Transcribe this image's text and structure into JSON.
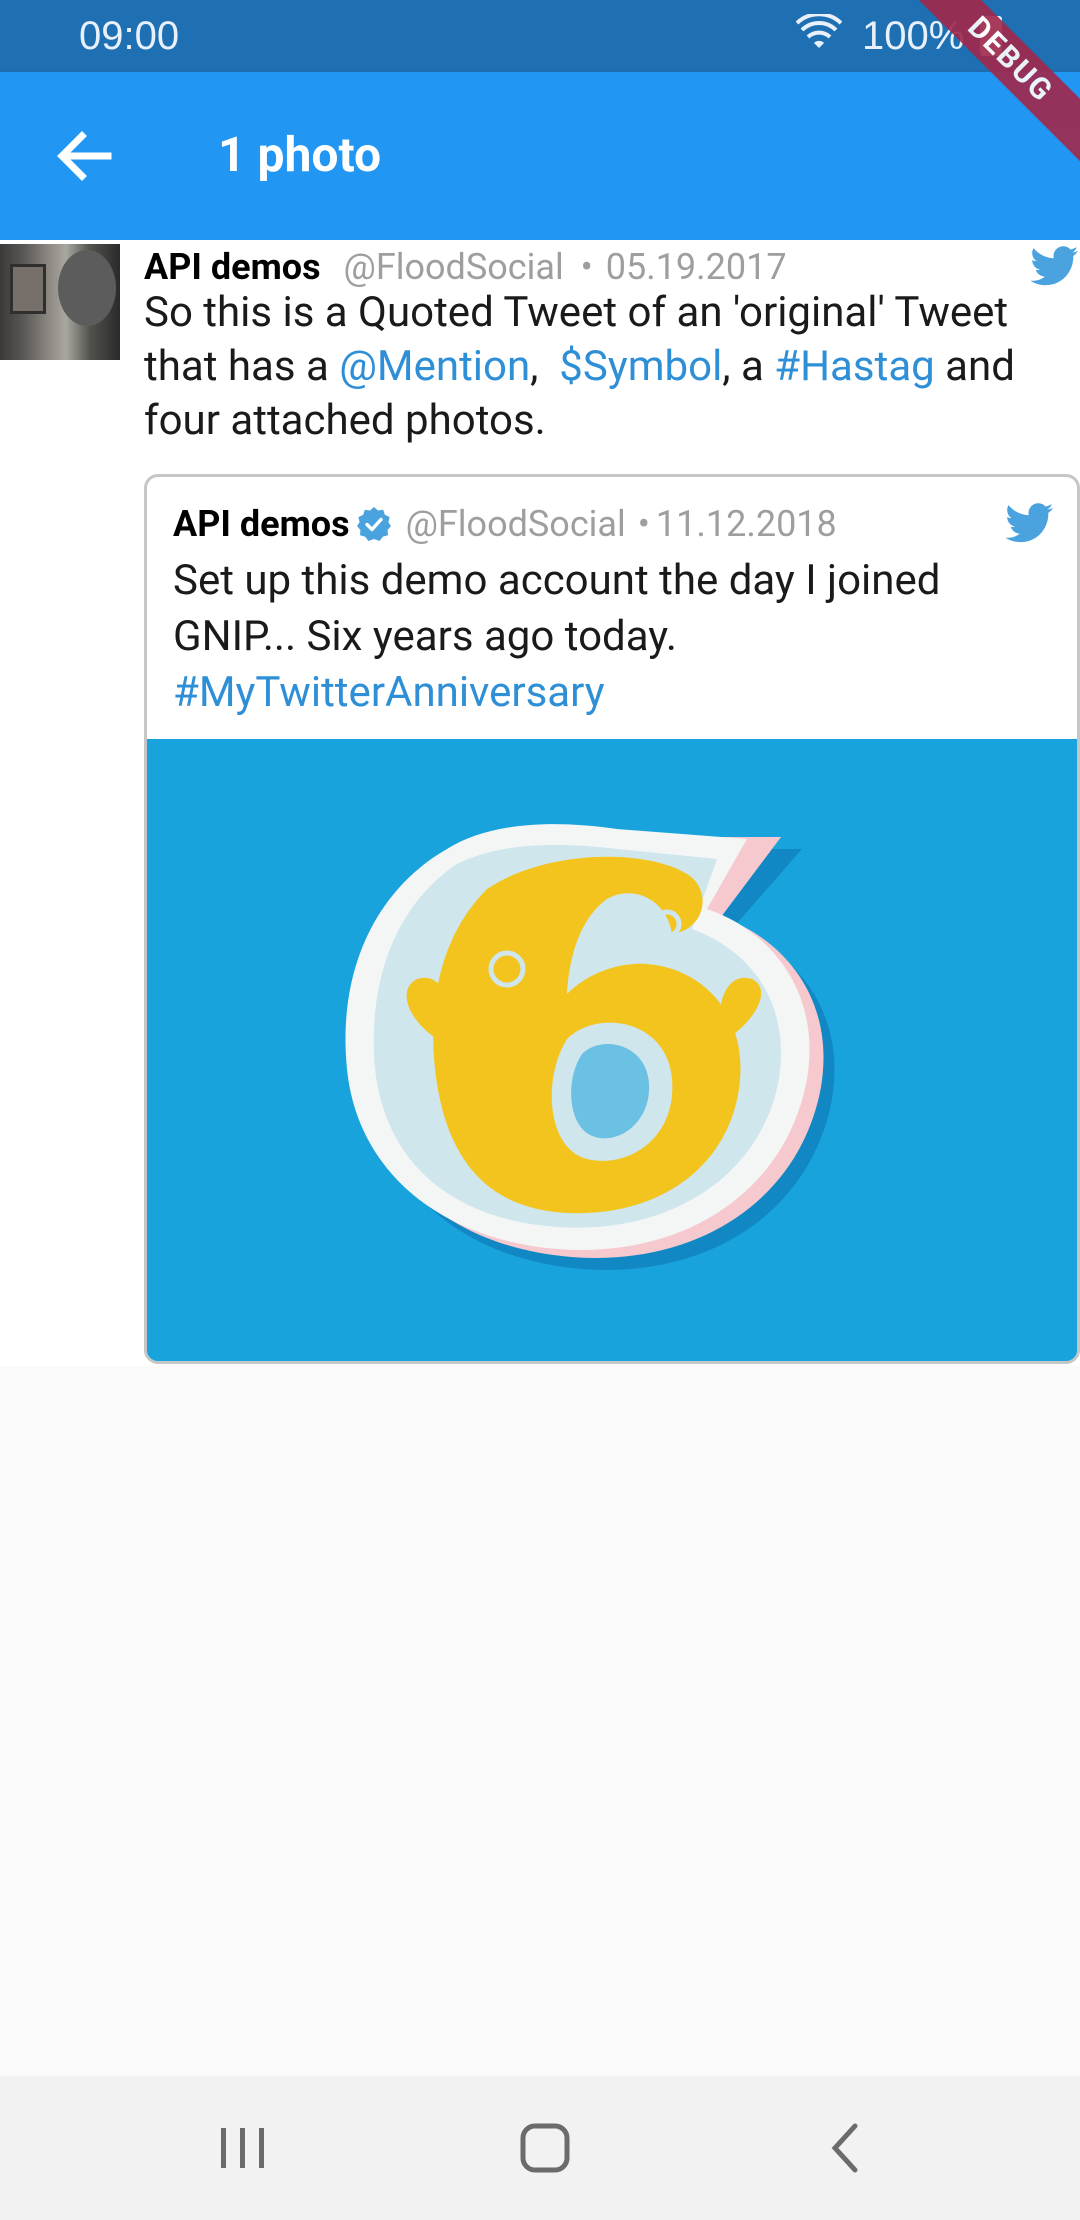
{
  "status_bar": {
    "time": "09:00",
    "battery": "100%",
    "icons": [
      "wifi-icon",
      "battery-icon"
    ]
  },
  "debug_banner": "DEBUG",
  "app_bar": {
    "back_icon": "arrow-back-icon",
    "title": "1 photo"
  },
  "tweet": {
    "author_name": "API demos",
    "handle": "@FloodSocial",
    "separator": "•",
    "date": "05.19.2017",
    "text": {
      "part1": "So this is a Quoted Tweet of an 'original' Tweet that has a ",
      "mention": "@Mention",
      "part2": ",  ",
      "symbol": "$Symbol",
      "part3": ", a ",
      "hashtag": "#Hastag",
      "part4": " and four attached photos."
    }
  },
  "quoted_tweet": {
    "author_name": "API demos",
    "verified_icon": "verified-badge-icon",
    "handle": "@FloodSocial",
    "separator": "•",
    "date": "11.12.2018",
    "text": "Set up this demo account the day I joined GNIP... Six years ago today.",
    "hashtag": "#MyTwitterAnniversary",
    "image": "yellow-number-six-papercraft-image"
  },
  "colors": {
    "app_bar": "#2196f3",
    "status_bar": "#1f6fb3",
    "link": "#2e8fd6",
    "twitter_blue": "#4aa3df",
    "image_bg": "#19a3dc"
  },
  "nav_bar": {
    "icons": [
      "recent-apps-icon",
      "home-icon",
      "back-icon"
    ]
  }
}
